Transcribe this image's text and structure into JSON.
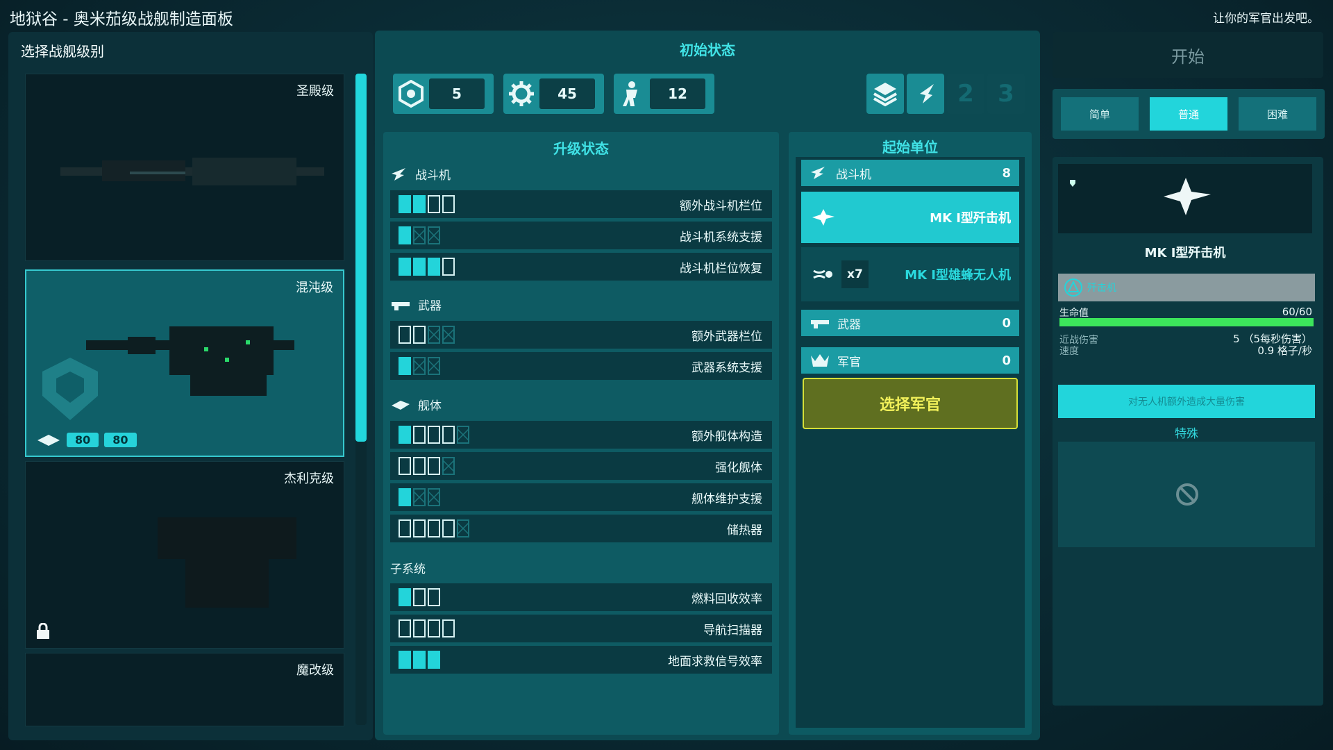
{
  "header": {
    "title": "地狱谷 - 奥米茄级战舰制造面板",
    "hint": "让你的军官出发吧。"
  },
  "left": {
    "title": "选择战舰级别",
    "ships": [
      {
        "name": "圣殿级"
      },
      {
        "name": "混沌级",
        "selected": true,
        "hull": "80",
        "armor": "80"
      },
      {
        "name": "杰利克级",
        "locked": true
      },
      {
        "name": "魔改级"
      }
    ]
  },
  "center": {
    "title": "初始状态",
    "stats": {
      "drones": "5",
      "parts": "45",
      "crew": "12"
    },
    "slots": [
      "2",
      "3"
    ]
  },
  "upgrades": {
    "title": "升级状态",
    "fighter": {
      "label": "战斗机",
      "rows": [
        "额外战斗机栏位",
        "战斗机系统支援",
        "战斗机栏位恢复"
      ]
    },
    "weapon": {
      "label": "武器",
      "rows": [
        "额外武器栏位",
        "武器系统支援"
      ]
    },
    "hull": {
      "label": "舰体",
      "rows": [
        "额外舰体构造",
        "强化舰体",
        "舰体维护支援",
        "储热器"
      ]
    },
    "subsystem": {
      "label": "子系统",
      "rows": [
        "燃料回收效率",
        "导航扫描器",
        "地面求救信号效率"
      ]
    }
  },
  "units": {
    "title": "起始单位",
    "fighter": {
      "label": "战斗机",
      "value": "8"
    },
    "interceptor": {
      "name": "MK I型歼击机"
    },
    "drone": {
      "count": "x7",
      "name": "MK I型雄蜂无人机"
    },
    "weapon": {
      "label": "武器",
      "value": "0"
    },
    "officer": {
      "label": "军官",
      "value": "0"
    },
    "select_officer": "选择军官"
  },
  "right": {
    "start": "开始",
    "difficulty": [
      "简单",
      "普通",
      "困难"
    ],
    "detail": {
      "name": "MK I型歼击机",
      "type": "歼击机",
      "hp_label": "生命值",
      "hp_value": "60/60",
      "hp_fraction": 1.0,
      "melee_label": "近战伤害",
      "speed_label": "速度",
      "melee_value": "5 （5每秒伤害）",
      "speed_value": "0.9 格子/秒",
      "ability": "对无人机额外造成大量伤害",
      "special_label": "特殊"
    }
  },
  "colors": {
    "accent": "#22d5db",
    "officer": "#d6e038",
    "hp": "#3ce55b"
  }
}
